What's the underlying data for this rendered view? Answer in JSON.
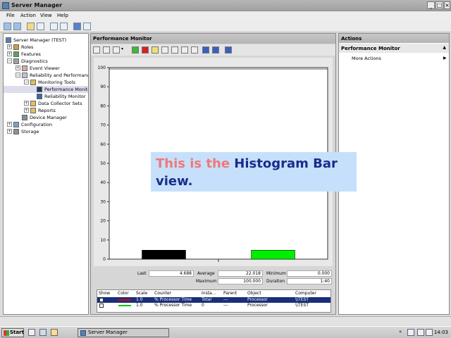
{
  "window": {
    "title": "Server Manager"
  },
  "menu": [
    "File",
    "Action",
    "View",
    "Help"
  ],
  "tree": [
    {
      "label": "Server Manager (TEST)",
      "indent": 0,
      "exp": ""
    },
    {
      "label": "Roles",
      "indent": 1,
      "exp": "+"
    },
    {
      "label": "Features",
      "indent": 1,
      "exp": "+"
    },
    {
      "label": "Diagnostics",
      "indent": 1,
      "exp": "−"
    },
    {
      "label": "Event Viewer",
      "indent": 2,
      "exp": "+"
    },
    {
      "label": "Reliability and Performance",
      "indent": 2,
      "exp": "−"
    },
    {
      "label": "Monitoring Tools",
      "indent": 3,
      "exp": "−"
    },
    {
      "label": "Performance Monitor",
      "indent": 4,
      "exp": ""
    },
    {
      "label": "Reliability Monitor",
      "indent": 4,
      "exp": ""
    },
    {
      "label": "Data Collector Sets",
      "indent": 3,
      "exp": "+"
    },
    {
      "label": "Reports",
      "indent": 3,
      "exp": "+"
    },
    {
      "label": "Device Manager",
      "indent": 2,
      "exp": ""
    },
    {
      "label": "Configuration",
      "indent": 1,
      "exp": "+"
    },
    {
      "label": "Storage",
      "indent": 1,
      "exp": "+"
    }
  ],
  "center": {
    "title": "Performance Monitor"
  },
  "chart_data": {
    "type": "bar",
    "categories": [
      "% Processor Time (Total)",
      "% Processor Time (0)"
    ],
    "values": [
      4.688,
      4.688
    ],
    "colors": [
      "#000000",
      "#00ee00"
    ],
    "ylim": [
      0,
      100
    ],
    "yticks": [
      "0",
      "10",
      "20",
      "30",
      "40",
      "50",
      "60",
      "70",
      "80",
      "90",
      "100"
    ],
    "grid": false
  },
  "stats": {
    "last_label": "Last",
    "last": "4.688",
    "average_label": "Average",
    "average": "22.018",
    "minimum_label": "Minimum",
    "minimum": "0.000",
    "maximum_label": "Maximum",
    "maximum": "100.000",
    "duration_label": "Duration",
    "duration": "1:40"
  },
  "legend": {
    "headers": [
      "Show",
      "Color",
      "Scale",
      "Counter",
      "Insta...",
      "Parent",
      "Object",
      "Computer"
    ],
    "rows": [
      {
        "scale": "1.0",
        "counter": "% Processor Time",
        "instance": "Total",
        "parent": "---",
        "object": "Processor",
        "computer": "\\\\TEST",
        "color": "#e00000"
      },
      {
        "scale": "1.0",
        "counter": "% Processor Time",
        "instance": "0",
        "parent": "---",
        "object": "Processor",
        "computer": "\\\\TEST",
        "color": "#00cc00"
      }
    ]
  },
  "actions": {
    "header": "Actions",
    "section": "Performance Monitor",
    "item": "More Actions"
  },
  "overlay": {
    "part1": "This is the ",
    "part2": "Histogram Bar",
    "part3": "view."
  },
  "taskbar": {
    "start": "Start",
    "task": "Server Manager",
    "clock": "14:03"
  },
  "colors": {
    "overlay_pink": "#f07878",
    "overlay_blue": "#1a2c8c",
    "selection": "#1a2f7a"
  }
}
